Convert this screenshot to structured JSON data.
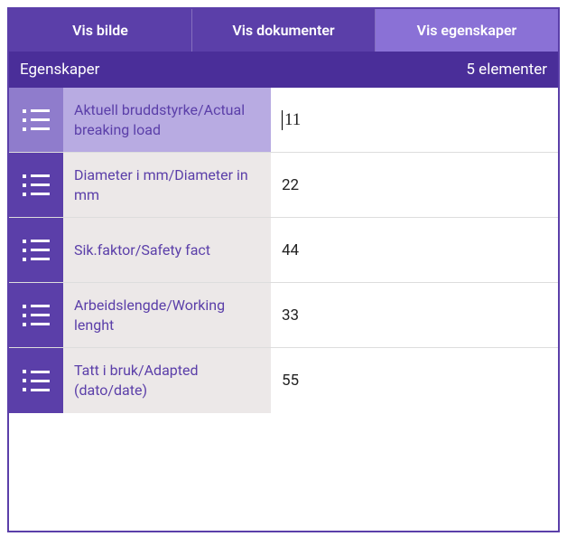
{
  "tabs": {
    "image": "Vis bilde",
    "documents": "Vis dokumenter",
    "properties": "Vis egenskaper"
  },
  "header": {
    "title": "Egenskaper",
    "count": "5 elementer"
  },
  "rows": [
    {
      "label": "Aktuell bruddstyrke/Actual breaking load",
      "value": "11",
      "selected": true
    },
    {
      "label": "Diameter i mm/Diameter in mm",
      "value": "22",
      "selected": false
    },
    {
      "label": "Sik.faktor/Safety fact",
      "value": "44",
      "selected": false
    },
    {
      "label": "Arbeidslengde/Working lenght",
      "value": "33",
      "selected": false
    },
    {
      "label": "Tatt i bruk/Adapted  (dato/date)",
      "value": "55",
      "selected": false
    }
  ]
}
